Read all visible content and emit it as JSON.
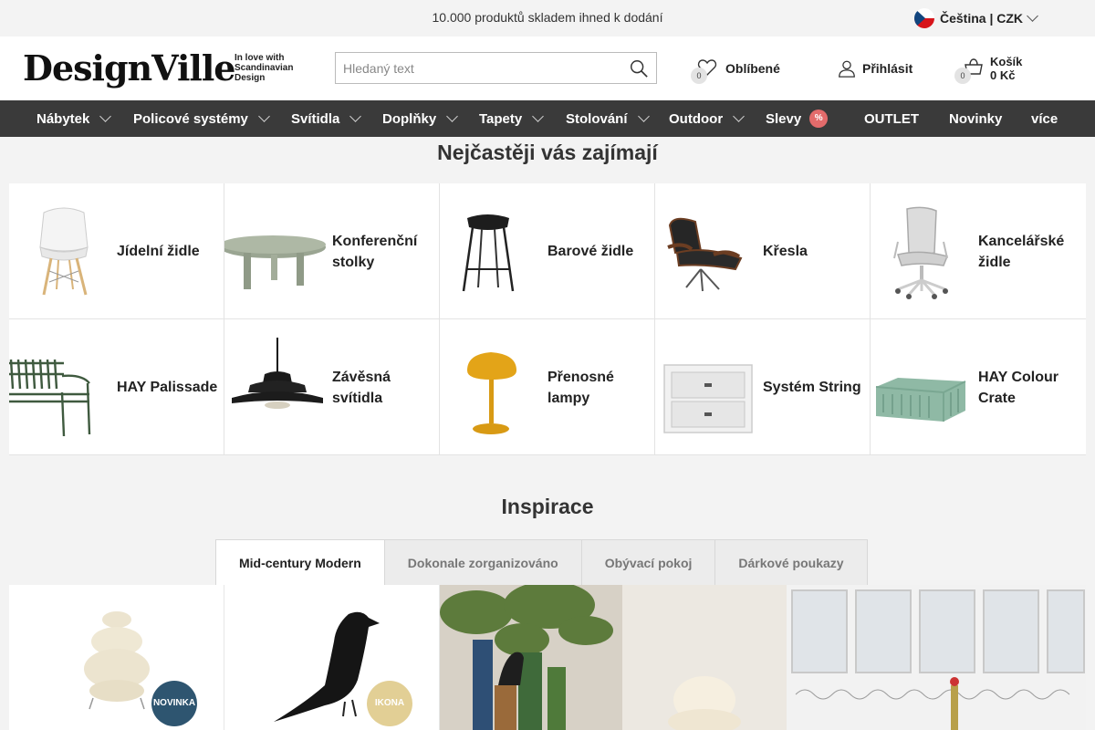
{
  "topbar": {
    "promo": "10.000 produktů skladem ihned k dodání",
    "language": "Čeština | CZK"
  },
  "header": {
    "logo": "DesignVille",
    "tagline": [
      "In love with",
      "Scandinavian",
      "Design"
    ],
    "search_placeholder": "Hledaný text",
    "favorites_label": "Oblíbené",
    "favorites_count": "0",
    "login_label": "Přihlásit",
    "cart_label": "Košík",
    "cart_total": "0 Kč",
    "cart_count": "0"
  },
  "nav": {
    "items": [
      {
        "label": "Nábytek"
      },
      {
        "label": "Policové systémy"
      },
      {
        "label": "Svítidla"
      },
      {
        "label": "Doplňky"
      },
      {
        "label": "Tapety"
      },
      {
        "label": "Stolování"
      },
      {
        "label": "Outdoor"
      },
      {
        "label": "Slevy"
      },
      {
        "label": "OUTLET"
      },
      {
        "label": "Novinky"
      },
      {
        "label": "více"
      }
    ],
    "sale_badge": "%"
  },
  "popular": {
    "title": "Nejčastěji vás zajímají",
    "categories": [
      {
        "label": "Jídelní židle",
        "icon": "dining-chair-icon"
      },
      {
        "label": "Konferenční stolky",
        "icon": "coffee-table-icon"
      },
      {
        "label": "Barové židle",
        "icon": "bar-stool-icon"
      },
      {
        "label": "Křesla",
        "icon": "lounge-chair-icon"
      },
      {
        "label": "Kancelářské židle",
        "icon": "office-chair-icon"
      },
      {
        "label": "HAY Palissade",
        "icon": "bench-icon"
      },
      {
        "label": "Závěsná svítidla",
        "icon": "pendant-lamp-icon"
      },
      {
        "label": "Přenosné lampy",
        "icon": "portable-lamp-icon"
      },
      {
        "label": "Systém String",
        "icon": "shelf-drawer-icon"
      },
      {
        "label": "HAY Colour Crate",
        "icon": "crate-icon"
      }
    ]
  },
  "inspiration": {
    "title": "Inspirace",
    "tabs": [
      {
        "label": "Mid-century Modern"
      },
      {
        "label": "Dokonale zorganizováno"
      },
      {
        "label": "Obývací pokoj"
      },
      {
        "label": "Dárkové poukazy"
      }
    ],
    "products": [
      {
        "badge": "NOVINKA",
        "badge_color": "#2e5570"
      },
      {
        "badge": "IKONA",
        "badge_color": "#e2cf95"
      }
    ]
  }
}
